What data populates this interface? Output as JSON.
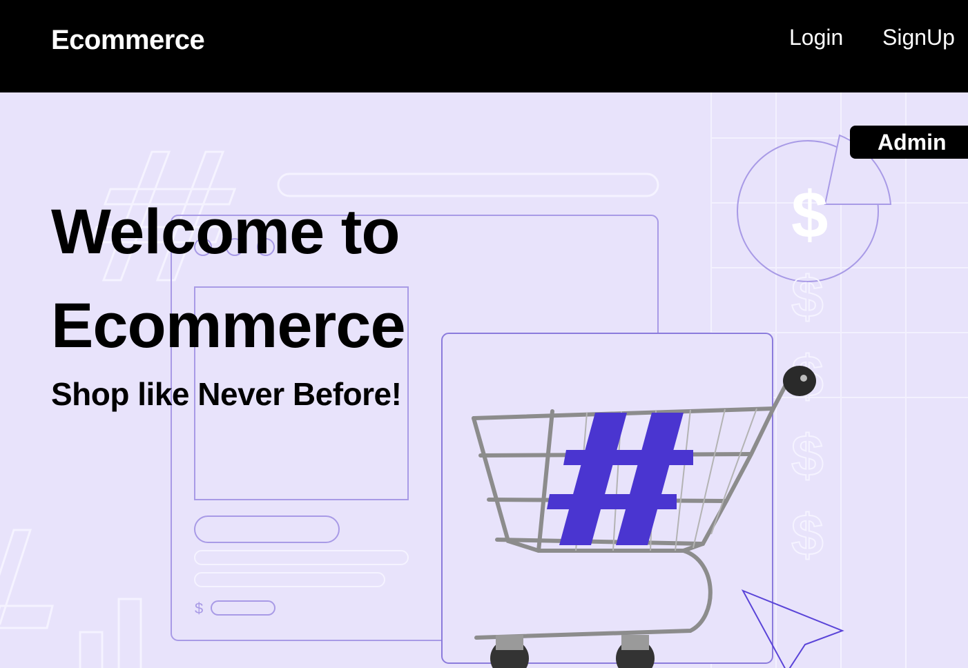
{
  "navbar": {
    "brand": "Ecommerce",
    "links": [
      {
        "label": "Login"
      },
      {
        "label": "SignUp"
      }
    ]
  },
  "hero": {
    "title_line1": "Welcome to",
    "title_line2": "Ecommerce",
    "subtitle": "Shop like Never Before!",
    "admin_label": "Admin",
    "illustration": {
      "price_symbol": "$",
      "hash_symbol": "#",
      "icons": [
        "shopping-cart-icon",
        "pie-chart-icon",
        "cursor-arrow-icon",
        "hashtag-icon",
        "dollar-icon"
      ]
    }
  },
  "colors": {
    "navbar_bg": "#000000",
    "hero_bg": "#e8e3fb",
    "accent": "#4a35d0",
    "line": "#a89ae6"
  }
}
